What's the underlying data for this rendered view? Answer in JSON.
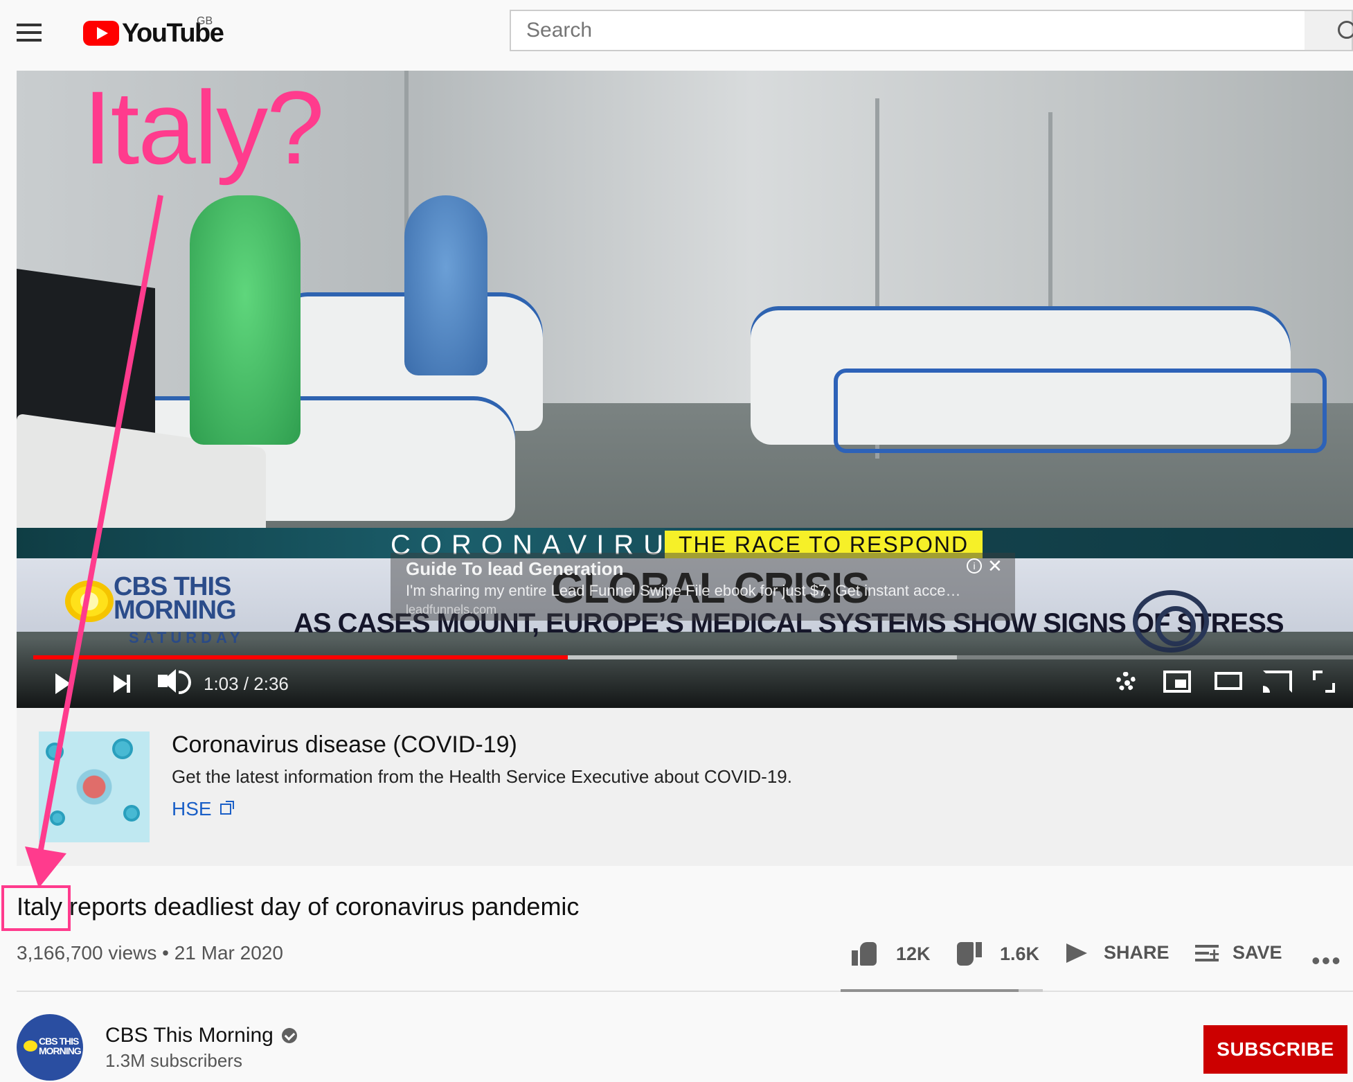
{
  "header": {
    "logo_text": "YouTube",
    "country_code": "GB",
    "search_placeholder": "Search"
  },
  "video": {
    "overlay_annotation": "Italy?",
    "chyron": {
      "band_title": "CORONAVIRUS",
      "band_subtitle": "THE RACE TO RESPOND",
      "headline": "GLOBAL CRISIS",
      "subheadline": "AS CASES MOUNT, EUROPE’S MEDICAL SYSTEMS SHOW SIGNS OF STRESS",
      "logo_line1": "CBS THIS",
      "logo_line2": "MORNING",
      "logo_line3": "SATURDAY"
    },
    "ad": {
      "title": "Guide To lead Generation",
      "description": "I'm sharing my entire Lead Funnel Swipe File ebook for just $7. Get instant acce…",
      "url": "leadfunnels.com",
      "info_glyph": "i",
      "close_glyph": "✕"
    },
    "player": {
      "time_current": "1:03",
      "time_total": "2:36",
      "time_display": "1:03 / 2:36",
      "played_fraction": 0.405,
      "buffered_fraction": 0.7
    }
  },
  "info_panel": {
    "title": "Coronavirus disease (COVID-19)",
    "description": "Get the latest information from the Health Service Executive about COVID-19.",
    "link_label": "HSE"
  },
  "video_info": {
    "title": "Italy reports deadliest day of coronavirus pandemic",
    "views": "3,166,700 views",
    "separator": "•",
    "date": "21 Mar 2020",
    "meta": "3,166,700 views • 21 Mar 2020",
    "likes": "12K",
    "dislikes": "1.6K",
    "like_fraction": 0.88,
    "share_label": "SHARE",
    "save_label": "SAVE",
    "more_glyph": "•••"
  },
  "channel": {
    "name": "CBS This Morning",
    "subscribers": "1.3M subscribers",
    "avatar_text": "CBS THIS MORNING",
    "subscribe_label": "SUBSCRIBE"
  },
  "colors": {
    "brand_red": "#ff0000",
    "subscribe_red": "#cc0000",
    "annotation_pink": "#ff3b8d",
    "link_blue": "#1a5fc7"
  }
}
